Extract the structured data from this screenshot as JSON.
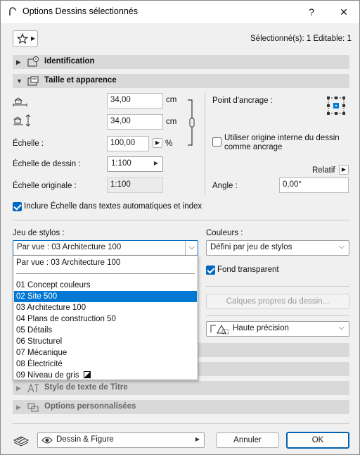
{
  "window": {
    "title": "Options Dessins sélectionnés",
    "help_label": "?",
    "close_label": "✕"
  },
  "header": {
    "selection_info": "Sélectionné(s): 1 Editable: 1"
  },
  "sections": {
    "identification": "Identification",
    "taille": "Taille et apparence",
    "style_titre": "Style de texte de Titre",
    "options_perso": "Options personnalisées"
  },
  "size": {
    "width_value": "34,00",
    "width_unit": "cm",
    "height_value": "34,00",
    "height_unit": "cm",
    "echelle_label": "Échelle :",
    "echelle_value": "100,00",
    "echelle_unit": "%",
    "echelle_dessin_label": "Échelle de dessin :",
    "echelle_dessin_value": "1:100",
    "echelle_originale_label": "Échelle originale :",
    "echelle_originale_value": "1:100"
  },
  "anchor": {
    "label": "Point d'ancrage :",
    "origine_label": "Utiliser origine interne du dessin comme ancrage",
    "origine_checked": false,
    "relatif_label": "Relatif",
    "angle_label": "Angle :",
    "angle_value": "0,00°"
  },
  "inclure": {
    "label": "Inclure Échelle dans textes automatiques et index",
    "checked": true
  },
  "pens": {
    "label": "Jeu de stylos :",
    "selected": "Par vue : 03 Architecture 100",
    "options": [
      "Par vue : 03 Architecture 100",
      "01 Concept couleurs",
      "02 Site 500",
      "03 Architecture 100",
      "04 Plans de construction 50",
      "05 Détails",
      "06 Structurel",
      "07 Mécanique",
      "08 Électricité",
      "09 Niveau de gris"
    ],
    "highlighted": "02 Site 500"
  },
  "colors": {
    "label": "Couleurs :",
    "selected": "Défini par jeu de stylos",
    "fond_label": "Fond transparent",
    "fond_checked": true,
    "calques_button": "Calques propres du dessin...",
    "quality": "Haute précision"
  },
  "footer": {
    "view_select": "Dessin & Figure",
    "cancel": "Annuler",
    "ok": "OK"
  },
  "theme": {
    "accent": "#0067c0",
    "highlight": "#0078d4",
    "section_bg": "#d9d9d9"
  }
}
